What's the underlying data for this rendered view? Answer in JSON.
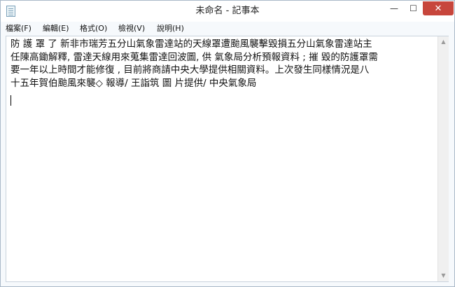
{
  "window": {
    "title": "未命名 - 記事本",
    "icon": "notepad-icon",
    "minimize_glyph": "—",
    "maximize_glyph": "☐",
    "close_glyph": "✕"
  },
  "menu": {
    "items": [
      {
        "label": "檔案(F)"
      },
      {
        "label": "編輯(E)"
      },
      {
        "label": "格式(O)"
      },
      {
        "label": "檢視(V)"
      },
      {
        "label": "說明(H)"
      }
    ]
  },
  "editor": {
    "content": "防 護 罩 了 新非市瑞芳五分山氣象雷達站的天線罩遭颱風襲擊毀損五分山氣象雷達站主\n任陳高鋤解釋, 雷達天線用來蒐集雷達回波圖, 供 氣象局分析預報資料 ; 摧 毀的防護罩需\n要一年以上時間才能修復 , 目前將商請中央大學提供相關資料。上次發生同樣情況是八\n十五年賀伯颱風來襲◇ 報導/ 王詣筑 圖 片提供/ 中央氣象局"
  },
  "scrollbar": {
    "up_glyph": "▲",
    "down_glyph": "▼"
  }
}
